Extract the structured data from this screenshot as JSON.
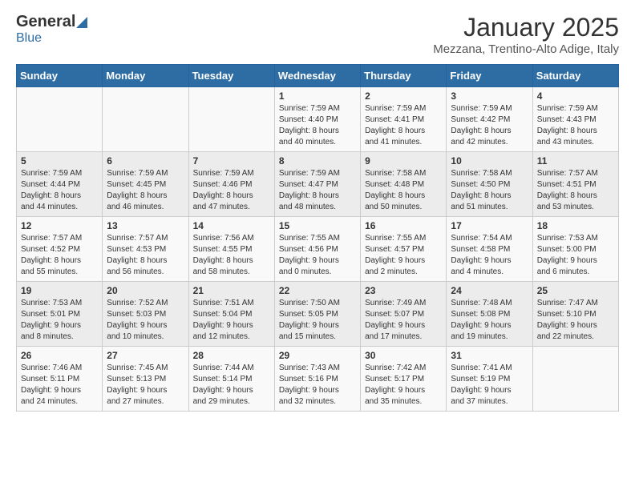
{
  "header": {
    "logo_general": "General",
    "logo_blue": "Blue",
    "month_title": "January 2025",
    "location": "Mezzana, Trentino-Alto Adige, Italy"
  },
  "days_of_week": [
    "Sunday",
    "Monday",
    "Tuesday",
    "Wednesday",
    "Thursday",
    "Friday",
    "Saturday"
  ],
  "weeks": [
    [
      {
        "day": "",
        "info": ""
      },
      {
        "day": "",
        "info": ""
      },
      {
        "day": "",
        "info": ""
      },
      {
        "day": "1",
        "info": "Sunrise: 7:59 AM\nSunset: 4:40 PM\nDaylight: 8 hours\nand 40 minutes."
      },
      {
        "day": "2",
        "info": "Sunrise: 7:59 AM\nSunset: 4:41 PM\nDaylight: 8 hours\nand 41 minutes."
      },
      {
        "day": "3",
        "info": "Sunrise: 7:59 AM\nSunset: 4:42 PM\nDaylight: 8 hours\nand 42 minutes."
      },
      {
        "day": "4",
        "info": "Sunrise: 7:59 AM\nSunset: 4:43 PM\nDaylight: 8 hours\nand 43 minutes."
      }
    ],
    [
      {
        "day": "5",
        "info": "Sunrise: 7:59 AM\nSunset: 4:44 PM\nDaylight: 8 hours\nand 44 minutes."
      },
      {
        "day": "6",
        "info": "Sunrise: 7:59 AM\nSunset: 4:45 PM\nDaylight: 8 hours\nand 46 minutes."
      },
      {
        "day": "7",
        "info": "Sunrise: 7:59 AM\nSunset: 4:46 PM\nDaylight: 8 hours\nand 47 minutes."
      },
      {
        "day": "8",
        "info": "Sunrise: 7:59 AM\nSunset: 4:47 PM\nDaylight: 8 hours\nand 48 minutes."
      },
      {
        "day": "9",
        "info": "Sunrise: 7:58 AM\nSunset: 4:48 PM\nDaylight: 8 hours\nand 50 minutes."
      },
      {
        "day": "10",
        "info": "Sunrise: 7:58 AM\nSunset: 4:50 PM\nDaylight: 8 hours\nand 51 minutes."
      },
      {
        "day": "11",
        "info": "Sunrise: 7:57 AM\nSunset: 4:51 PM\nDaylight: 8 hours\nand 53 minutes."
      }
    ],
    [
      {
        "day": "12",
        "info": "Sunrise: 7:57 AM\nSunset: 4:52 PM\nDaylight: 8 hours\nand 55 minutes."
      },
      {
        "day": "13",
        "info": "Sunrise: 7:57 AM\nSunset: 4:53 PM\nDaylight: 8 hours\nand 56 minutes."
      },
      {
        "day": "14",
        "info": "Sunrise: 7:56 AM\nSunset: 4:55 PM\nDaylight: 8 hours\nand 58 minutes."
      },
      {
        "day": "15",
        "info": "Sunrise: 7:55 AM\nSunset: 4:56 PM\nDaylight: 9 hours\nand 0 minutes."
      },
      {
        "day": "16",
        "info": "Sunrise: 7:55 AM\nSunset: 4:57 PM\nDaylight: 9 hours\nand 2 minutes."
      },
      {
        "day": "17",
        "info": "Sunrise: 7:54 AM\nSunset: 4:58 PM\nDaylight: 9 hours\nand 4 minutes."
      },
      {
        "day": "18",
        "info": "Sunrise: 7:53 AM\nSunset: 5:00 PM\nDaylight: 9 hours\nand 6 minutes."
      }
    ],
    [
      {
        "day": "19",
        "info": "Sunrise: 7:53 AM\nSunset: 5:01 PM\nDaylight: 9 hours\nand 8 minutes."
      },
      {
        "day": "20",
        "info": "Sunrise: 7:52 AM\nSunset: 5:03 PM\nDaylight: 9 hours\nand 10 minutes."
      },
      {
        "day": "21",
        "info": "Sunrise: 7:51 AM\nSunset: 5:04 PM\nDaylight: 9 hours\nand 12 minutes."
      },
      {
        "day": "22",
        "info": "Sunrise: 7:50 AM\nSunset: 5:05 PM\nDaylight: 9 hours\nand 15 minutes."
      },
      {
        "day": "23",
        "info": "Sunrise: 7:49 AM\nSunset: 5:07 PM\nDaylight: 9 hours\nand 17 minutes."
      },
      {
        "day": "24",
        "info": "Sunrise: 7:48 AM\nSunset: 5:08 PM\nDaylight: 9 hours\nand 19 minutes."
      },
      {
        "day": "25",
        "info": "Sunrise: 7:47 AM\nSunset: 5:10 PM\nDaylight: 9 hours\nand 22 minutes."
      }
    ],
    [
      {
        "day": "26",
        "info": "Sunrise: 7:46 AM\nSunset: 5:11 PM\nDaylight: 9 hours\nand 24 minutes."
      },
      {
        "day": "27",
        "info": "Sunrise: 7:45 AM\nSunset: 5:13 PM\nDaylight: 9 hours\nand 27 minutes."
      },
      {
        "day": "28",
        "info": "Sunrise: 7:44 AM\nSunset: 5:14 PM\nDaylight: 9 hours\nand 29 minutes."
      },
      {
        "day": "29",
        "info": "Sunrise: 7:43 AM\nSunset: 5:16 PM\nDaylight: 9 hours\nand 32 minutes."
      },
      {
        "day": "30",
        "info": "Sunrise: 7:42 AM\nSunset: 5:17 PM\nDaylight: 9 hours\nand 35 minutes."
      },
      {
        "day": "31",
        "info": "Sunrise: 7:41 AM\nSunset: 5:19 PM\nDaylight: 9 hours\nand 37 minutes."
      },
      {
        "day": "",
        "info": ""
      }
    ]
  ]
}
